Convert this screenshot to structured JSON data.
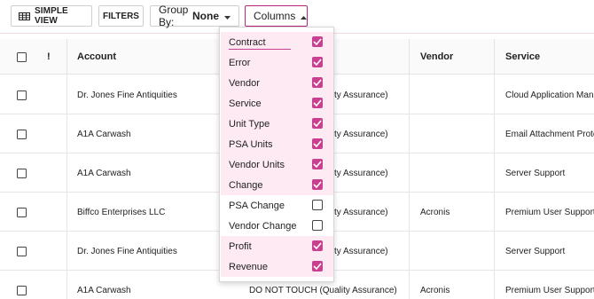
{
  "toolbar": {
    "simple_view": "SIMPLE VIEW",
    "filters": "FILTERS",
    "group_by_label": "Group By:",
    "group_by_value": "None",
    "columns": "Columns"
  },
  "table": {
    "headers": {
      "flag": "!",
      "account": "Account",
      "vendor": "Vendor",
      "service": "Service"
    },
    "rows": [
      {
        "account": "Dr. Jones Fine Antiquities",
        "hidden_text": "ality Assurance)",
        "vendor": "",
        "service": "Cloud Application Mana"
      },
      {
        "account": "A1A Carwash",
        "hidden_text": "ality Assurance)",
        "vendor": "",
        "service": "Email Attachment Protec"
      },
      {
        "account": "A1A Carwash",
        "hidden_text": "ality Assurance)",
        "vendor": "",
        "service": "Server Support"
      },
      {
        "account": "Biffco Enterprises LLC",
        "hidden_text": "ality Assurance)",
        "vendor": "Acronis",
        "service": "Premium User Support"
      },
      {
        "account": "Dr. Jones Fine Antiquities",
        "hidden_text": "ality Assurance)",
        "vendor": "",
        "service": "Server Support"
      },
      {
        "account": "A1A Carwash",
        "hidden_text": "DO NOT TOUCH (Quality Assurance)",
        "vendor": "Acronis",
        "service": "Premium User Support"
      }
    ]
  },
  "columns_menu": {
    "options": [
      {
        "label": "Contract",
        "checked": true
      },
      {
        "label": "Error",
        "checked": true
      },
      {
        "label": "Vendor",
        "checked": true
      },
      {
        "label": "Service",
        "checked": true
      },
      {
        "label": "Unit Type",
        "checked": true
      },
      {
        "label": "PSA Units",
        "checked": true
      },
      {
        "label": "Vendor Units",
        "checked": true
      },
      {
        "label": "Change",
        "checked": true
      },
      {
        "label": "PSA Change",
        "checked": false
      },
      {
        "label": "Vendor Change",
        "checked": false
      },
      {
        "label": "Profit",
        "checked": true
      },
      {
        "label": "Revenue",
        "checked": true
      }
    ]
  },
  "colors": {
    "accent": "#c8408f",
    "accent_light": "#fdeaf3"
  }
}
